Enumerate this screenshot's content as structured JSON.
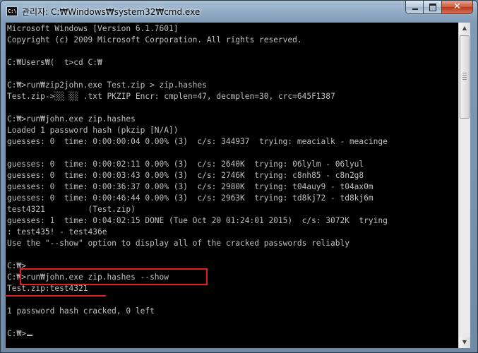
{
  "window": {
    "title": "관리자: C:₩Windows₩system32₩cmd.exe",
    "icon": "console-icon",
    "icon_label": "C:\\"
  },
  "titlebar_buttons": {
    "minimize": "minimize-icon",
    "maximize": "maximize-icon",
    "close": "close-icon",
    "close_glyph": "✕"
  },
  "console": {
    "lines": [
      "Microsoft Windows [Version 6.1.7601]",
      "Copyright (c) 2009 Microsoft Corporation. All rights reserved.",
      "",
      "C:₩Users₩(  t>cd C:₩",
      "",
      "C:₩>run₩zip2john.exe Test.zip > zip.hashes",
      "Test.zip->░░ ░░ .txt PKZIP Encr: cmplen=47, decmplen=30, crc=645F1387",
      "",
      "C:₩>run₩john.exe zip.hashes",
      "Loaded 1 password hash (pkzip [N/A])",
      "guesses: 0  time: 0:00:00:04 0.00% (3)  c/s: 344937  trying: meacialk - meacinge",
      "",
      "guesses: 0  time: 0:00:02:11 0.00% (3)  c/s: 2640K  trying: 06lylm - 06lyul",
      "guesses: 0  time: 0:00:03:43 0.00% (3)  c/s: 2746K  trying: c8nh85 - c8n2g8",
      "guesses: 0  time: 0:00:36:37 0.00% (3)  c/s: 2980K  trying: t04auy9 - t04ax0m",
      "guesses: 0  time: 0:00:46:44 0.00% (3)  c/s: 2963K  trying: td8kj72 - td8kj6m",
      "test4321         (Test.zip)",
      "guesses: 1  time: 0:04:02:15 DONE (Tue Oct 20 01:24:01 2015)  c/s: 3072K  trying",
      ": test435! - test436e",
      "Use the \"--show\" option to display all of the cracked passwords reliably",
      "",
      "C:₩>",
      "C:₩>run₩john.exe zip.hashes --show",
      "Test.zip:test4321",
      "",
      "1 password hash cracked, 0 left",
      "",
      "C:₩>"
    ]
  },
  "scrollbar": {
    "up_arrow": "▲",
    "down_arrow": "▼",
    "position_fraction": 0.0
  },
  "annotations": {
    "box_color": "#e02020",
    "underline_color": "#e02020"
  }
}
